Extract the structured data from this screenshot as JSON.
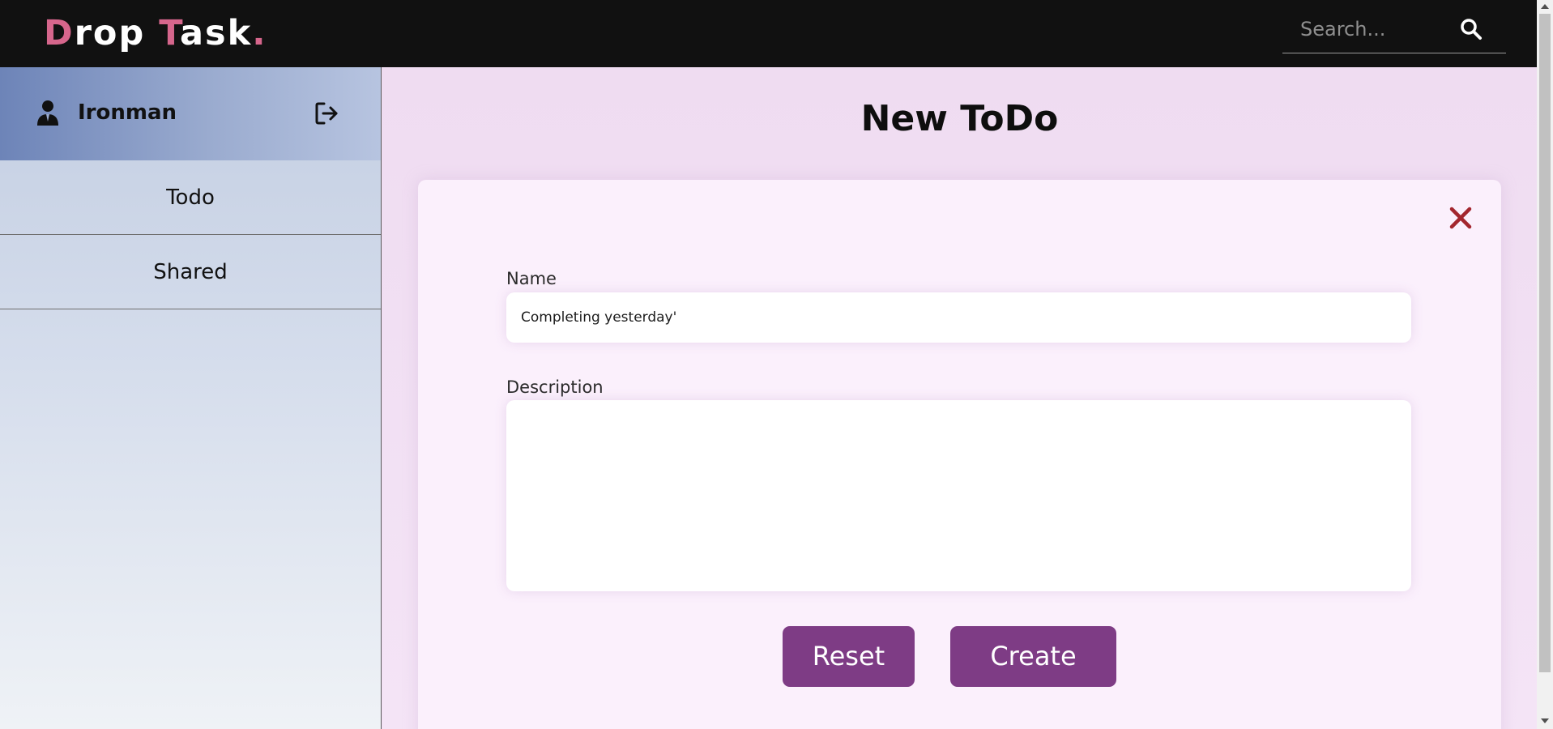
{
  "app": {
    "logo_part1_accent": "D",
    "logo_part1_rest": "rop ",
    "logo_part2_accent": "T",
    "logo_part2_rest": "ask",
    "logo_dot": "."
  },
  "header": {
    "search": {
      "placeholder": "Search...",
      "value": ""
    },
    "search_icon": "search-icon"
  },
  "sidebar": {
    "user": {
      "name": "Ironman",
      "icon": "user-icon",
      "logout_icon": "logout-icon"
    },
    "items": [
      {
        "label": "Todo"
      },
      {
        "label": "Shared"
      }
    ]
  },
  "main": {
    "title": "New ToDo",
    "form": {
      "close_icon": "close-icon",
      "name_label": "Name",
      "name_value": "Completing yesterday'",
      "description_label": "Description",
      "description_value": "",
      "reset_label": "Reset",
      "create_label": "Create"
    }
  },
  "colors": {
    "topbar": "#111111",
    "logo_accent": "#d6668c",
    "button": "#7e3c85",
    "close": "#a3262e",
    "main_bg": "#f0ddf2"
  }
}
